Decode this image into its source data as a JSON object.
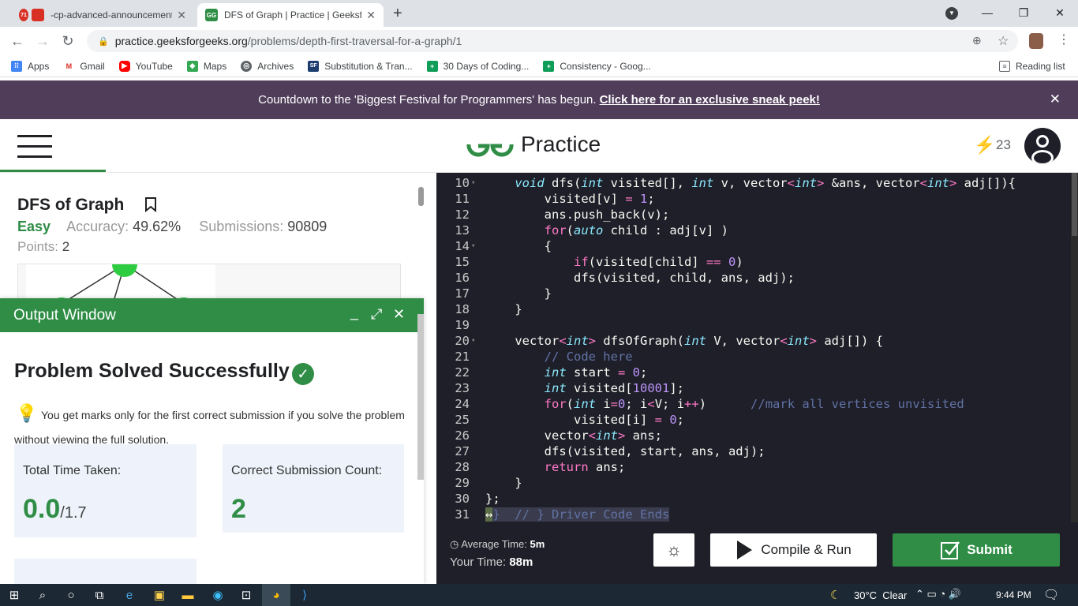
{
  "browser": {
    "tabs": [
      {
        "title": "-cp-advanced-announcement",
        "favicon": "gmail-icon"
      },
      {
        "title": "DFS of Graph | Practice | GeeksforGeeks",
        "favicon": "gfg-icon"
      }
    ],
    "tab_badge": "71",
    "url_host": "practice.geeksforgeeks.org",
    "url_path": "/problems/depth-first-traversal-for-a-graph/1",
    "bookmarks": [
      "Apps",
      "Gmail",
      "YouTube",
      "Maps",
      "Archives",
      "Substitution & Tran...",
      "30 Days of Coding...",
      "Consistency - Goog..."
    ],
    "reading_list": "Reading list"
  },
  "banner": {
    "text": "Countdown to the 'Biggest Festival for Programmers' has begun.",
    "link": "Click here for an exclusive sneak peek!"
  },
  "header": {
    "brand": "Practice",
    "streak": "23"
  },
  "problem": {
    "title": "DFS of Graph",
    "difficulty": "Easy",
    "accuracy_label": "Accuracy:",
    "accuracy": "49.62%",
    "submissions_label": "Submissions:",
    "submissions": "90809",
    "points_label": "Points:",
    "points": "2"
  },
  "output_window": {
    "title": "Output Window",
    "status": "Problem Solved Successfully",
    "tip": "You get marks only for the first correct submission if you solve the problem without viewing the full solution.",
    "cards": [
      {
        "label": "Total Time Taken:",
        "value": "0.0",
        "suffix": "/1.7"
      },
      {
        "label": "Correct Submission Count:",
        "value": "2",
        "suffix": ""
      }
    ]
  },
  "code": {
    "lines": [
      {
        "n": "10",
        "fold": true,
        "html": "    <span class=\"ty\">void</span> dfs(<span class=\"ty\">int</span> visited[], <span class=\"ty\">int</span> v, vector<span class=\"kw\">&lt;</span><span class=\"ty\">int</span><span class=\"kw\">&gt;</span> &amp;ans, vector<span class=\"kw\">&lt;</span><span class=\"ty\">int</span><span class=\"kw\">&gt;</span> adj[]){"
      },
      {
        "n": "11",
        "fold": false,
        "html": "        visited[v] <span class=\"kw\">=</span> <span class=\"nm\">1</span>;"
      },
      {
        "n": "12",
        "fold": false,
        "html": "        ans.push_back(v);"
      },
      {
        "n": "13",
        "fold": false,
        "html": "        <span class=\"kw\">for</span>(<span class=\"ty\">auto</span> child : adj[v] )"
      },
      {
        "n": "14",
        "fold": true,
        "html": "        {"
      },
      {
        "n": "15",
        "fold": false,
        "html": "            <span class=\"kw\">if</span>(visited[child] <span class=\"kw\">==</span> <span class=\"nm\">0</span>)"
      },
      {
        "n": "16",
        "fold": false,
        "html": "            dfs(visited, child, ans, adj);"
      },
      {
        "n": "17",
        "fold": false,
        "html": "        }"
      },
      {
        "n": "18",
        "fold": false,
        "html": "    }"
      },
      {
        "n": "19",
        "fold": false,
        "html": ""
      },
      {
        "n": "20",
        "fold": true,
        "html": "    vector<span class=\"kw\">&lt;</span><span class=\"ty\">int</span><span class=\"kw\">&gt;</span> dfsOfGraph(<span class=\"ty\">int</span> V, vector<span class=\"kw\">&lt;</span><span class=\"ty\">int</span><span class=\"kw\">&gt;</span> adj[]) {"
      },
      {
        "n": "21",
        "fold": false,
        "html": "        <span class=\"cm\">// Code here</span>"
      },
      {
        "n": "22",
        "fold": false,
        "html": "        <span class=\"ty\">int</span> start <span class=\"kw\">=</span> <span class=\"nm\">0</span>;"
      },
      {
        "n": "23",
        "fold": false,
        "html": "        <span class=\"ty\">int</span> visited[<span class=\"nm\">10001</span>];"
      },
      {
        "n": "24",
        "fold": false,
        "html": "        <span class=\"kw\">for</span>(<span class=\"ty\">int</span> i<span class=\"kw\">=</span><span class=\"nm\">0</span>; i<span class=\"kw\">&lt;</span>V; i<span class=\"kw\">++</span>)      <span class=\"cm\">//mark all vertices unvisited</span>"
      },
      {
        "n": "25",
        "fold": false,
        "html": "            visited[i] <span class=\"kw\">=</span> <span class=\"nm\">0</span>;"
      },
      {
        "n": "26",
        "fold": false,
        "html": "        vector<span class=\"kw\">&lt;</span><span class=\"ty\">int</span><span class=\"kw\">&gt;</span> ans;"
      },
      {
        "n": "27",
        "fold": false,
        "html": "        dfs(visited, start, ans, adj);"
      },
      {
        "n": "28",
        "fold": false,
        "html": "        <span class=\"kw\">return</span> ans;"
      },
      {
        "n": "29",
        "fold": false,
        "html": "    }"
      },
      {
        "n": "30",
        "fold": false,
        "html": "};"
      },
      {
        "n": "31",
        "fold": false,
        "html": "<span style=\"background:#5c6d4a\">&#8596;</span><span class=\"cm\">}  // } Driver Code Ends</span>"
      }
    ]
  },
  "footer": {
    "avg_time_label": "Average Time:",
    "avg_time": "5m",
    "your_time_label": "Your Time:",
    "your_time": "88m",
    "compile_label": "Compile & Run",
    "submit_label": "Submit"
  },
  "taskbar": {
    "weather": "30°C  Clear",
    "time": "9:44 PM"
  },
  "colors": {
    "green": "#2f8d46",
    "banner": "#4f3d5a",
    "editor_bg": "#1e1f29"
  }
}
